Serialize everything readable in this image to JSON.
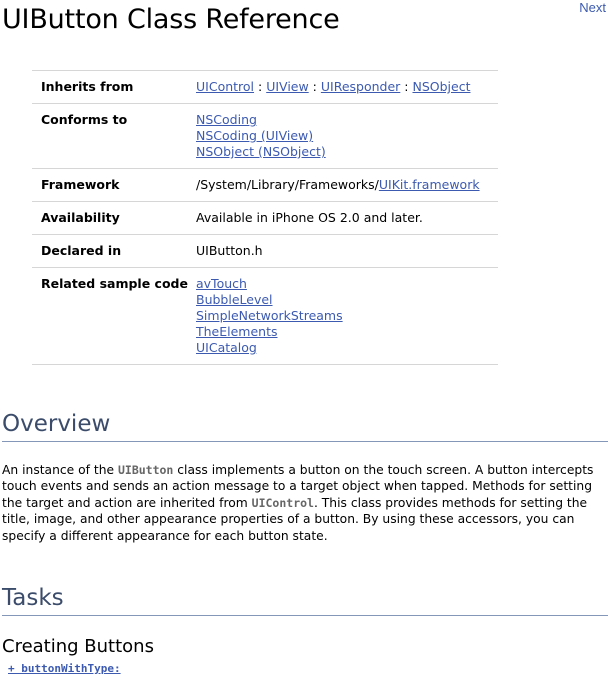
{
  "nav": {
    "next_label": "Next"
  },
  "page": {
    "title": "UIButton Class Reference"
  },
  "spec_table": {
    "inherits_from": {
      "label": "Inherits from",
      "items": [
        "UIControl",
        "UIView",
        "UIResponder",
        "NSObject"
      ],
      "separator": " : "
    },
    "conforms_to": {
      "label": "Conforms to",
      "items": [
        "NSCoding",
        "NSCoding (UIView)",
        "NSObject (NSObject)"
      ]
    },
    "framework": {
      "label": "Framework",
      "path": "/System/Library/Frameworks/",
      "link": "UIKit.framework"
    },
    "availability": {
      "label": "Availability",
      "value": "Available in iPhone OS 2.0 and later."
    },
    "declared_in": {
      "label": "Declared in",
      "value": "UIButton.h"
    },
    "related_sample_code": {
      "label": "Related sample code",
      "items": [
        "avTouch",
        "BubbleLevel",
        "SimpleNetworkStreams",
        "TheElements",
        "UICatalog"
      ]
    }
  },
  "overview": {
    "title": "Overview",
    "text_1": "An instance of the ",
    "code_1": "UIButton",
    "text_2": " class implements a button on the touch screen. A button intercepts touch events and sends an action message to a target object when tapped. Methods for setting the target and action are inherited from ",
    "code_2": "UIControl",
    "text_3": ". This class provides methods for setting the title, image, and other appearance properties of a button. By using these accessors, you can specify a different appearance for each button state."
  },
  "tasks": {
    "title": "Tasks",
    "subsection_title": "Creating Buttons",
    "methods": [
      "+ buttonWithType:"
    ]
  },
  "colors": {
    "link": "#3c5ab0",
    "section_heading": "#3b4c6b",
    "rule": "#8497b9"
  }
}
